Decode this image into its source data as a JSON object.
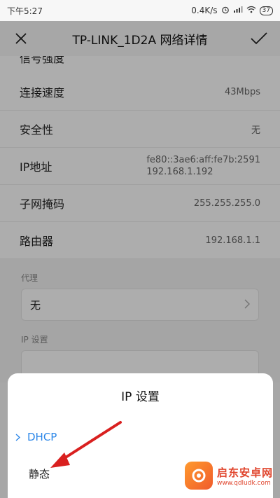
{
  "status_bar": {
    "time": "下午5:27",
    "net_speed": "0.4K/s",
    "battery": "37"
  },
  "header": {
    "title": "TP-LINK_1D2A  网络详情"
  },
  "details": {
    "partial_label": "信号强度",
    "rows": [
      {
        "label": "连接速度",
        "value": "43Mbps"
      },
      {
        "label": "安全性",
        "value": "无"
      },
      {
        "label": "IP地址",
        "value_line1": "fe80::3ae6:aff:fe7b:2591",
        "value_line2": "192.168.1.192"
      },
      {
        "label": "子网掩码",
        "value": "255.255.255.0"
      },
      {
        "label": "路由器",
        "value": "192.168.1.1"
      }
    ]
  },
  "proxy": {
    "label": "代理",
    "value": "无"
  },
  "ip_settings": {
    "label": "IP 设置"
  },
  "sheet": {
    "title": "IP  设置",
    "options": [
      "DHCP",
      "静态"
    ]
  },
  "watermark": {
    "cn": "启东安卓网",
    "en": "www.qdludk.com"
  },
  "colors": {
    "accent": "#2a86e8",
    "arrow": "#d9201f"
  }
}
